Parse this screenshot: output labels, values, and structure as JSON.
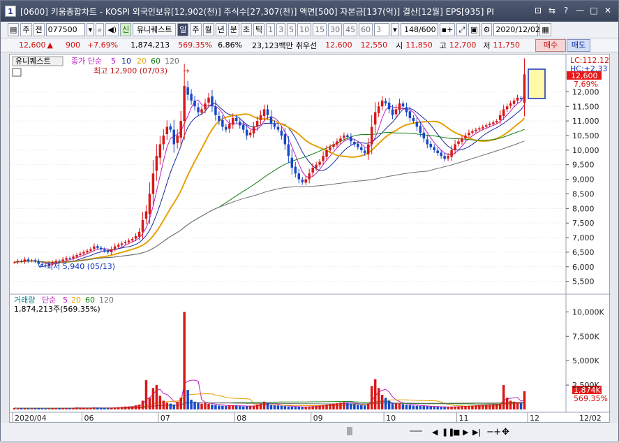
{
  "window": {
    "number": "1",
    "title": "[0600] 키움종합차트 - KOSPI 외국인보유[12,902(천)] 주식수[27,307(천)] 액면[500] 자본금[137(억)] 결산[12월] EPS[935] PI"
  },
  "toolbar": {
    "mode": "주",
    "prev": "전",
    "code": "077500",
    "stock_new": "신",
    "stock_name": "유니퀘스트",
    "periods": [
      "일",
      "주",
      "월",
      "년",
      "분",
      "초",
      "틱"
    ],
    "minutes": [
      "1",
      "3",
      "5",
      "10",
      "15",
      "30",
      "45",
      "60"
    ],
    "interval": "3",
    "count": "148/600",
    "date": "2020/12/02"
  },
  "quote": {
    "price": "12,600",
    "arrow": "▲",
    "change": "900",
    "change_pct": "+7.69%",
    "volume": "1,874,213",
    "vol_ratio": "569.35%",
    "turnover": "6.86%",
    "amount": "23,123백만",
    "preferred": "취우선",
    "bid1": "12,600",
    "bid2": "12,550",
    "open_label": "시",
    "open": "11,850",
    "high_label": "고",
    "high": "12,700",
    "low_label": "저",
    "low": "11,750",
    "buy": "매수",
    "sell": "매도"
  },
  "price_panel": {
    "legend": {
      "name": "유니퀘스트",
      "ma_label": "종가 단순",
      "ma": [
        "5",
        "10",
        "20",
        "60",
        "120"
      ]
    },
    "max_note": "최고 12,900 (07/03)",
    "min_note": "최저 5,940 (05/13)",
    "lc": "LC:112.12",
    "hc": "HC:+2.33",
    "last_price": "12,600",
    "last_pct": "7.69%",
    "y_ticks": [
      "12,000",
      "11,500",
      "11,000",
      "10,500",
      "10,000",
      "9,500",
      "9,000",
      "8,500",
      "8,000",
      "7,500",
      "7,000",
      "6,500",
      "6,000",
      "5,500"
    ]
  },
  "volume_panel": {
    "legend": {
      "name": "거래량",
      "ma_label": "단순",
      "ma": [
        "5",
        "20",
        "60",
        "120"
      ]
    },
    "value_note": "1,874,213주(569.35%)",
    "last_vol": "1,874K",
    "last_pct": "569.35%",
    "y_ticks": [
      "10,000K",
      "7,500K",
      "5,000K",
      "2,500K"
    ]
  },
  "x_labels": [
    "2020/04",
    "06",
    "07",
    "08",
    "09",
    "10",
    "11",
    "12",
    "12/02"
  ],
  "colors": {
    "up": "#d81818",
    "down": "#1848c8",
    "ma5": "#c020c0",
    "ma10": "#1828a0",
    "ma20": "#e8a000",
    "ma60": "#108010",
    "ma120": "#707070"
  },
  "chart_data": {
    "type": "candlestick",
    "price_range": [
      5300,
      12800
    ],
    "volume_range": [
      0,
      10600
    ],
    "volume_unit": "K",
    "closes": [
      6150,
      6200,
      6180,
      6250,
      6200,
      6220,
      6180,
      6100,
      6050,
      6020,
      6100,
      6150,
      6200,
      6180,
      6250,
      6300,
      6280,
      6350,
      6400,
      6450,
      6500,
      6550,
      6600,
      6700,
      6650,
      6600,
      6550,
      6500,
      6600,
      6700,
      6750,
      6800,
      6850,
      6900,
      6950,
      7050,
      7200,
      7600,
      7900,
      8500,
      9200,
      9800,
      10200,
      10500,
      10800,
      10700,
      10200,
      10500,
      11000,
      12200,
      11900,
      11700,
      11500,
      11300,
      11400,
      11600,
      11800,
      11500,
      11200,
      11000,
      10800,
      10700,
      10900,
      11100,
      11000,
      10850,
      10700,
      10500,
      10600,
      10800,
      11000,
      11200,
      11400,
      11200,
      10900,
      10800,
      10700,
      10500,
      10200,
      9800,
      9400,
      9200,
      9000,
      8900,
      9000,
      9200,
      9400,
      9500,
      9600,
      9800,
      10000,
      10100,
      10200,
      10300,
      10400,
      10500,
      10450,
      10300,
      10200,
      10100,
      10000,
      9900,
      10200,
      10800,
      11300,
      11500,
      11700,
      11600,
      11400,
      11200,
      11400,
      11600,
      11500,
      11300,
      11100,
      11000,
      10800,
      10600,
      10400,
      10200,
      10100,
      10000,
      9900,
      9800,
      9700,
      9800,
      10000,
      10200,
      10300,
      10400,
      10500,
      10600,
      10650,
      10700,
      10750,
      10800,
      10850,
      10900,
      10950,
      11000,
      11200,
      11400,
      11500,
      11600,
      11700,
      11800,
      11750,
      12600
    ],
    "volumes": [
      150,
      120,
      140,
      130,
      110,
      100,
      120,
      130,
      110,
      90,
      100,
      140,
      120,
      130,
      150,
      140,
      120,
      160,
      200,
      180,
      150,
      130,
      140,
      210,
      190,
      160,
      140,
      120,
      170,
      200,
      230,
      260,
      300,
      310,
      330,
      420,
      500,
      900,
      3000,
      1200,
      2200,
      2500,
      1400,
      900,
      700,
      600,
      500,
      800,
      1200,
      10000,
      2000,
      1000,
      800,
      700,
      600,
      650,
      600,
      500,
      450,
      400,
      380,
      350,
      400,
      420,
      380,
      340,
      300,
      320,
      380,
      400,
      500,
      600,
      800,
      650,
      450,
      420,
      400,
      380,
      350,
      300,
      280,
      260,
      250,
      240,
      260,
      300,
      340,
      360,
      400,
      450,
      500,
      550,
      600,
      650,
      700,
      750,
      700,
      600,
      550,
      500,
      450,
      420,
      600,
      2400,
      3100,
      2200,
      1500,
      1200,
      900,
      700,
      650,
      600,
      550,
      500,
      450,
      400,
      380,
      360,
      340,
      320,
      300,
      280,
      260,
      250,
      240,
      260,
      280,
      300,
      320,
      340,
      360,
      380,
      400,
      420,
      440,
      460,
      480,
      500,
      520,
      540,
      600,
      2500,
      1200,
      900,
      800,
      700,
      650,
      1874
    ]
  }
}
